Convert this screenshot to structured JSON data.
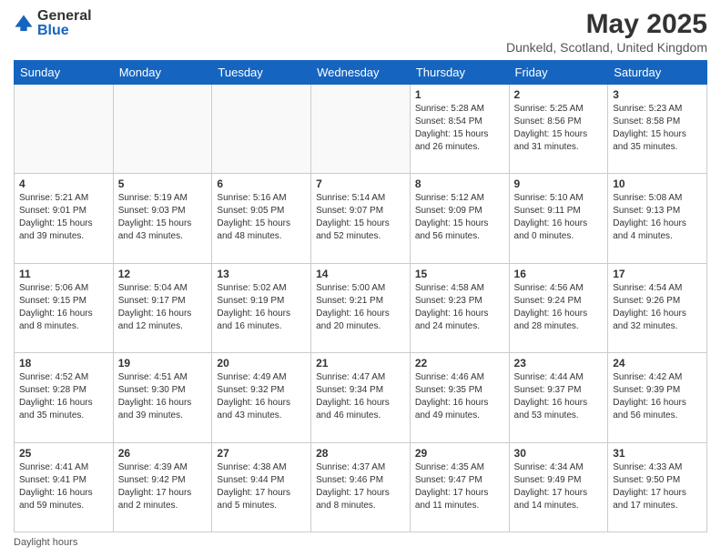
{
  "logo": {
    "general": "General",
    "blue": "Blue"
  },
  "title": "May 2025",
  "subtitle": "Dunkeld, Scotland, United Kingdom",
  "days_of_week": [
    "Sunday",
    "Monday",
    "Tuesday",
    "Wednesday",
    "Thursday",
    "Friday",
    "Saturday"
  ],
  "footer": {
    "label": "Daylight hours"
  },
  "weeks": [
    [
      {
        "num": "",
        "info": ""
      },
      {
        "num": "",
        "info": ""
      },
      {
        "num": "",
        "info": ""
      },
      {
        "num": "",
        "info": ""
      },
      {
        "num": "1",
        "info": "Sunrise: 5:28 AM\nSunset: 8:54 PM\nDaylight: 15 hours\nand 26 minutes."
      },
      {
        "num": "2",
        "info": "Sunrise: 5:25 AM\nSunset: 8:56 PM\nDaylight: 15 hours\nand 31 minutes."
      },
      {
        "num": "3",
        "info": "Sunrise: 5:23 AM\nSunset: 8:58 PM\nDaylight: 15 hours\nand 35 minutes."
      }
    ],
    [
      {
        "num": "4",
        "info": "Sunrise: 5:21 AM\nSunset: 9:01 PM\nDaylight: 15 hours\nand 39 minutes."
      },
      {
        "num": "5",
        "info": "Sunrise: 5:19 AM\nSunset: 9:03 PM\nDaylight: 15 hours\nand 43 minutes."
      },
      {
        "num": "6",
        "info": "Sunrise: 5:16 AM\nSunset: 9:05 PM\nDaylight: 15 hours\nand 48 minutes."
      },
      {
        "num": "7",
        "info": "Sunrise: 5:14 AM\nSunset: 9:07 PM\nDaylight: 15 hours\nand 52 minutes."
      },
      {
        "num": "8",
        "info": "Sunrise: 5:12 AM\nSunset: 9:09 PM\nDaylight: 15 hours\nand 56 minutes."
      },
      {
        "num": "9",
        "info": "Sunrise: 5:10 AM\nSunset: 9:11 PM\nDaylight: 16 hours\nand 0 minutes."
      },
      {
        "num": "10",
        "info": "Sunrise: 5:08 AM\nSunset: 9:13 PM\nDaylight: 16 hours\nand 4 minutes."
      }
    ],
    [
      {
        "num": "11",
        "info": "Sunrise: 5:06 AM\nSunset: 9:15 PM\nDaylight: 16 hours\nand 8 minutes."
      },
      {
        "num": "12",
        "info": "Sunrise: 5:04 AM\nSunset: 9:17 PM\nDaylight: 16 hours\nand 12 minutes."
      },
      {
        "num": "13",
        "info": "Sunrise: 5:02 AM\nSunset: 9:19 PM\nDaylight: 16 hours\nand 16 minutes."
      },
      {
        "num": "14",
        "info": "Sunrise: 5:00 AM\nSunset: 9:21 PM\nDaylight: 16 hours\nand 20 minutes."
      },
      {
        "num": "15",
        "info": "Sunrise: 4:58 AM\nSunset: 9:23 PM\nDaylight: 16 hours\nand 24 minutes."
      },
      {
        "num": "16",
        "info": "Sunrise: 4:56 AM\nSunset: 9:24 PM\nDaylight: 16 hours\nand 28 minutes."
      },
      {
        "num": "17",
        "info": "Sunrise: 4:54 AM\nSunset: 9:26 PM\nDaylight: 16 hours\nand 32 minutes."
      }
    ],
    [
      {
        "num": "18",
        "info": "Sunrise: 4:52 AM\nSunset: 9:28 PM\nDaylight: 16 hours\nand 35 minutes."
      },
      {
        "num": "19",
        "info": "Sunrise: 4:51 AM\nSunset: 9:30 PM\nDaylight: 16 hours\nand 39 minutes."
      },
      {
        "num": "20",
        "info": "Sunrise: 4:49 AM\nSunset: 9:32 PM\nDaylight: 16 hours\nand 43 minutes."
      },
      {
        "num": "21",
        "info": "Sunrise: 4:47 AM\nSunset: 9:34 PM\nDaylight: 16 hours\nand 46 minutes."
      },
      {
        "num": "22",
        "info": "Sunrise: 4:46 AM\nSunset: 9:35 PM\nDaylight: 16 hours\nand 49 minutes."
      },
      {
        "num": "23",
        "info": "Sunrise: 4:44 AM\nSunset: 9:37 PM\nDaylight: 16 hours\nand 53 minutes."
      },
      {
        "num": "24",
        "info": "Sunrise: 4:42 AM\nSunset: 9:39 PM\nDaylight: 16 hours\nand 56 minutes."
      }
    ],
    [
      {
        "num": "25",
        "info": "Sunrise: 4:41 AM\nSunset: 9:41 PM\nDaylight: 16 hours\nand 59 minutes."
      },
      {
        "num": "26",
        "info": "Sunrise: 4:39 AM\nSunset: 9:42 PM\nDaylight: 17 hours\nand 2 minutes."
      },
      {
        "num": "27",
        "info": "Sunrise: 4:38 AM\nSunset: 9:44 PM\nDaylight: 17 hours\nand 5 minutes."
      },
      {
        "num": "28",
        "info": "Sunrise: 4:37 AM\nSunset: 9:46 PM\nDaylight: 17 hours\nand 8 minutes."
      },
      {
        "num": "29",
        "info": "Sunrise: 4:35 AM\nSunset: 9:47 PM\nDaylight: 17 hours\nand 11 minutes."
      },
      {
        "num": "30",
        "info": "Sunrise: 4:34 AM\nSunset: 9:49 PM\nDaylight: 17 hours\nand 14 minutes."
      },
      {
        "num": "31",
        "info": "Sunrise: 4:33 AM\nSunset: 9:50 PM\nDaylight: 17 hours\nand 17 minutes."
      }
    ]
  ]
}
